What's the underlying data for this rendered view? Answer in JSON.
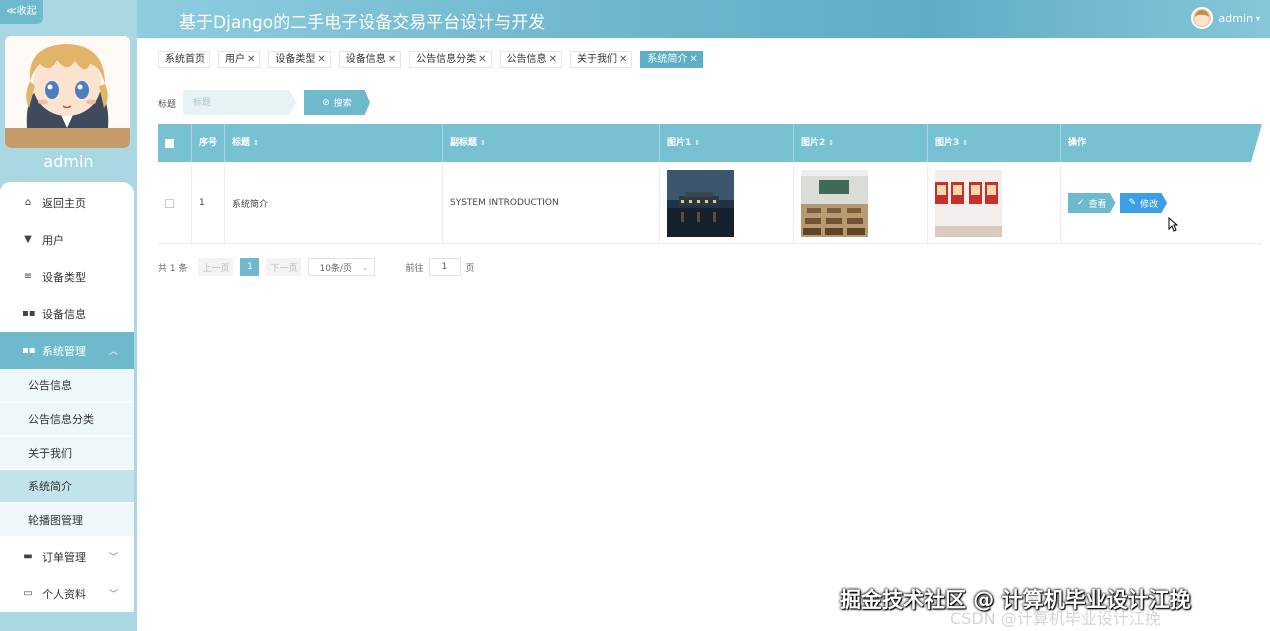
{
  "header": {
    "title": "基于Django的二手电子设备交易平台设计与开发",
    "user": "admin"
  },
  "sidebar": {
    "collapse_label": "≪收起",
    "username": "admin",
    "items": [
      {
        "label": "返回主页",
        "icon": "home-icon"
      },
      {
        "label": "用户",
        "icon": "user-icon"
      },
      {
        "label": "设备类型",
        "icon": "list-icon"
      },
      {
        "label": "设备信息",
        "icon": "grid-icon"
      },
      {
        "label": "系统管理",
        "icon": "grid-icon"
      }
    ],
    "sub_items": [
      {
        "label": "公告信息"
      },
      {
        "label": "公告信息分类"
      },
      {
        "label": "关于我们"
      },
      {
        "label": "系统简介"
      },
      {
        "label": "轮播图管理"
      }
    ],
    "bottom_items": [
      {
        "label": "订单管理",
        "icon": "monitor-icon"
      },
      {
        "label": "个人资料",
        "icon": "calendar-icon"
      }
    ]
  },
  "tabs": [
    {
      "label": "系统首页",
      "closable": false
    },
    {
      "label": "用户",
      "closable": true
    },
    {
      "label": "设备类型",
      "closable": true
    },
    {
      "label": "设备信息",
      "closable": true
    },
    {
      "label": "公告信息分类",
      "closable": true
    },
    {
      "label": "公告信息",
      "closable": true
    },
    {
      "label": "关于我们",
      "closable": true
    },
    {
      "label": "系统简介",
      "closable": true,
      "active": true
    }
  ],
  "search": {
    "label": "标题",
    "placeholder": "标题",
    "button": "搜索"
  },
  "table": {
    "headers": {
      "index": "序号",
      "title": "标题",
      "subtitle": "副标题",
      "img1": "图片1",
      "img2": "图片2",
      "img3": "图片3",
      "actions": "操作"
    },
    "rows": [
      {
        "index": "1",
        "title": "系统简介",
        "subtitle": "SYSTEM INTRODUCTION"
      }
    ],
    "view_label": "查看",
    "edit_label": "修改"
  },
  "pagination": {
    "total": "共 1 条",
    "prev": "上一页",
    "page": "1",
    "next": "下一页",
    "page_size": "10条/页",
    "goto": "前往",
    "goto_value": "1",
    "page_unit": "页"
  },
  "watermark": {
    "text": "掘金技术社区 @ 计算机毕业设计江挽",
    "text2": "CSDN @计算机毕业设计江挽"
  },
  "colors": {
    "accent": "#6fb9cc",
    "sidebar_bg": "#a9d8e3",
    "header_bg": "#72bad0",
    "edit_btn": "#3d9ee6"
  }
}
